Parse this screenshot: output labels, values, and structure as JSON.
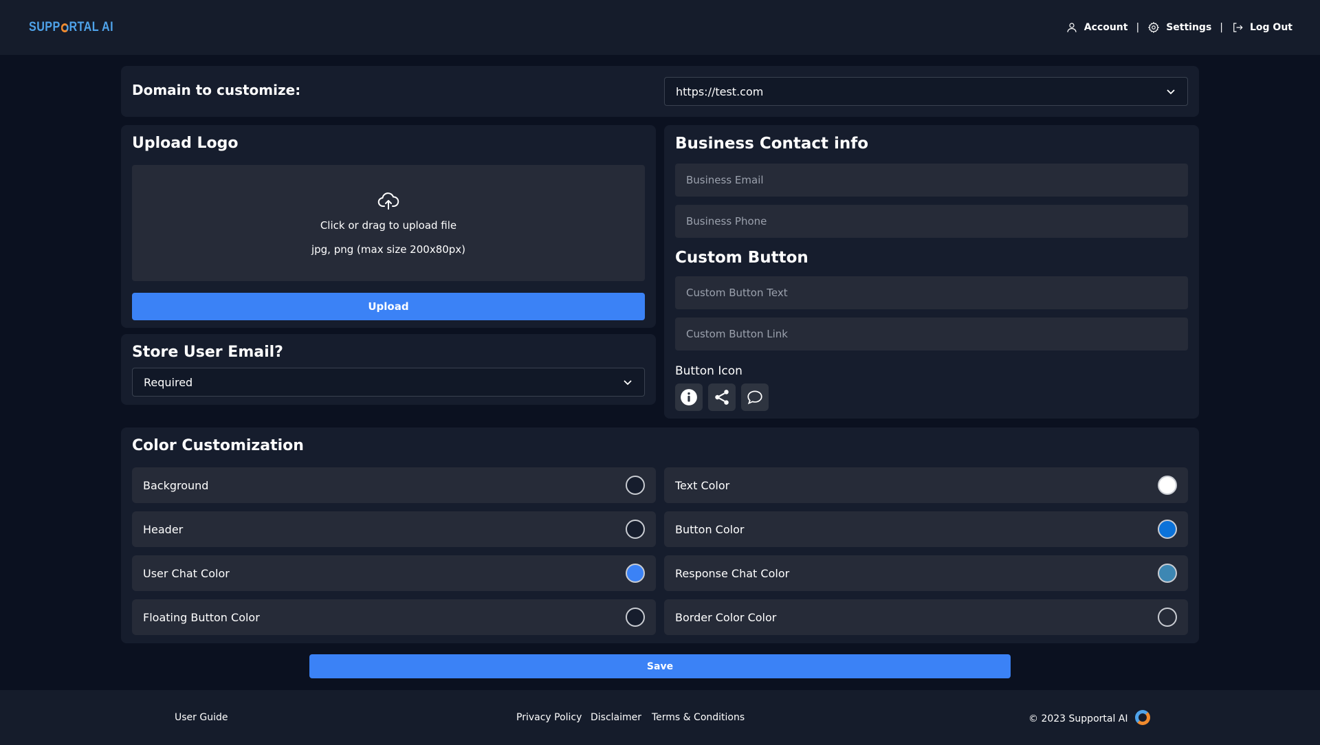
{
  "header": {
    "logo_text_1": "SUPP",
    "logo_text_2": "RTAL AI",
    "account_label": "Account",
    "settings_label": "Settings",
    "logout_label": "Log Out",
    "separator": "|"
  },
  "domain": {
    "label": "Domain to customize:",
    "selected": "https://test.com"
  },
  "upload_logo": {
    "title": "Upload Logo",
    "drop_text": "Click or drag to upload file",
    "hint": "jpg, png (max size 200x80px)",
    "button_label": "Upload"
  },
  "store_email": {
    "title": "Store User Email?",
    "selected": "Required"
  },
  "contact": {
    "title": "Business Contact info",
    "email_placeholder": "Business Email",
    "phone_placeholder": "Business Phone"
  },
  "custom_button": {
    "title": "Custom Button",
    "text_placeholder": "Custom Button Text",
    "link_placeholder": "Custom Button Link",
    "icon_label": "Button Icon",
    "icons": [
      "info-icon",
      "share-icon",
      "chat-bubble-icon"
    ]
  },
  "colors": {
    "title": "Color Customization",
    "left": [
      {
        "label": "Background",
        "color": "#161d2d"
      },
      {
        "label": "Header",
        "color": "#161d2d"
      },
      {
        "label": "User Chat Color",
        "color": "#3b82f6"
      },
      {
        "label": "Floating Button Color",
        "color": "#161d2d"
      }
    ],
    "right": [
      {
        "label": "Text Color",
        "color": "#ffffff"
      },
      {
        "label": "Button Color",
        "color": "#0b72d9"
      },
      {
        "label": "Response Chat Color",
        "color": "#3d87b3"
      },
      {
        "label": "Border Color Color",
        "color": "#262b38"
      }
    ]
  },
  "save_label": "Save",
  "footer": {
    "user_guide": "User Guide",
    "privacy": "Privacy Policy",
    "disclaimer": "Disclaimer",
    "terms": "Terms & Conditions",
    "copyright": "© 2023 Supportal AI"
  }
}
